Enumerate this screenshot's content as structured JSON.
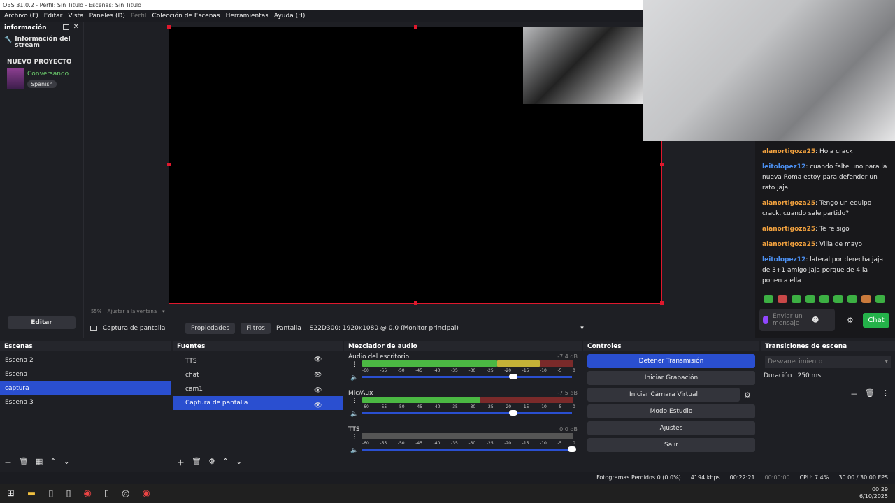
{
  "window": {
    "title": "OBS 31.0.2 - Perfil: Sin Titulo - Escenas: Sin Titulo"
  },
  "menu": [
    "Archivo (F)",
    "Editar",
    "Vista",
    "Paneles (D)",
    "Perfil",
    "Colección de Escenas",
    "Herramientas",
    "Ayuda (H)"
  ],
  "info_dock": {
    "title": "información",
    "item": "Información del stream",
    "project": "NUEVO PROYECTO",
    "category": "Conversando",
    "language": "Spanish",
    "edit_label": "Editar"
  },
  "preview": {
    "zoom": "55%",
    "fit_label": "Ajustar a la ventana"
  },
  "source_bar": {
    "source_name": "Captura de pantalla",
    "properties": "Propiedades",
    "filters": "Filtros",
    "display_label": "Pantalla",
    "display_value": "S22D300: 1920x1080 @ 0,0 (Monitor principal)"
  },
  "scenes": {
    "title": "Escenas",
    "items": [
      "Escena 2",
      "Escena",
      "captura",
      "Escena 3"
    ],
    "selected": 2
  },
  "sources": {
    "title": "Fuentes",
    "items": [
      "TTS",
      "chat",
      "cam1",
      "Captura de pantalla"
    ],
    "selected": 3
  },
  "mixer": {
    "title": "Mezclador de audio",
    "channels": [
      {
        "name": "Audio del escritorio",
        "db": "-7.4 dB",
        "level": 0.84
      },
      {
        "name": "Mic/Aux",
        "db": "-7.5 dB",
        "level": 0.56
      },
      {
        "name": "TTS",
        "db": "0.0 dB",
        "level": 0.0
      }
    ],
    "ticks": [
      "-60",
      "-55",
      "-50",
      "-45",
      "-40",
      "-35",
      "-30",
      "-25",
      "-20",
      "-15",
      "-10",
      "-5",
      "0"
    ]
  },
  "controls": {
    "title": "Controles",
    "buttons": [
      "Detener Transmisión",
      "Iniciar Grabación",
      "Iniciar Cámara Virtual",
      "Modo Estudio",
      "Ajustes",
      "Salir"
    ]
  },
  "transitions": {
    "title": "Transiciones de escena",
    "type": "Desvanecimiento",
    "duration_label": "Duración",
    "duration_value": "250 ms"
  },
  "chat": {
    "messages": [
      {
        "user": "alanortigoza25",
        "text": ": Hola crack",
        "color": "orange"
      },
      {
        "user": "leitolopez12",
        "text": ": cuando falte uno para la nueva Roma estoy para defender un rato jaja",
        "color": "blue"
      },
      {
        "user": "alanortigoza25",
        "text": ": Tengo un equipo crack, cuando sale partido?",
        "color": "orange"
      },
      {
        "user": "alanortigoza25",
        "text": ": Te re sigo",
        "color": "orange"
      },
      {
        "user": "alanortigoza25",
        "text": ": Villa de mayo",
        "color": "orange"
      },
      {
        "user": "leitolopez12",
        "text": ": lateral por derecha jaja de 3+1 amigo jaja porque de 4 la ponen a ella",
        "color": "blue"
      }
    ],
    "input_placeholder": "Enviar un mensaje",
    "send_label": "Chat"
  },
  "status": {
    "dropped": "Fotogramas Perdidos 0 (0.0%)",
    "bitrate": "4194 kbps",
    "live_time": "00:22:21",
    "rec_time": "00:00:00",
    "cpu": "CPU: 7.4%",
    "fps": "30.00 / 30.00 FPS"
  },
  "taskbar": {
    "time": "00:29",
    "date": "6/10/2025"
  }
}
